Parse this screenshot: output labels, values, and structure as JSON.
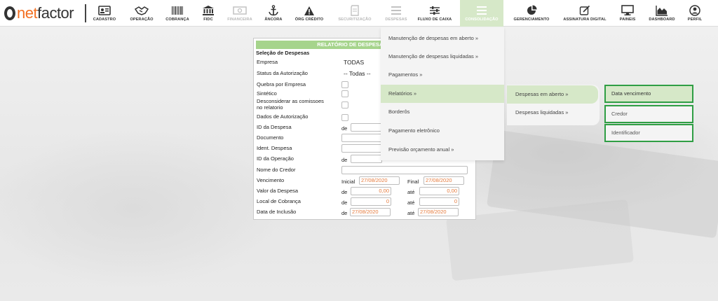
{
  "app": {
    "brand_net": "net",
    "brand_factor": "factor"
  },
  "nav": [
    {
      "key": "cadastro",
      "label": "CADASTRO",
      "icon": "id-card-icon",
      "disabled": false
    },
    {
      "key": "operacao",
      "label": "OPERAÇÃO",
      "icon": "handshake-icon",
      "disabled": false
    },
    {
      "key": "cobranca",
      "label": "COBRANÇA",
      "icon": "barcode-icon",
      "disabled": false
    },
    {
      "key": "fidc",
      "label": "FIDC",
      "icon": "bank-icon",
      "disabled": false
    },
    {
      "key": "financeira",
      "label": "FINANCEIRA",
      "icon": "money-icon",
      "disabled": true
    },
    {
      "key": "ancora",
      "label": "ÂNCORA",
      "icon": "anchor-icon",
      "disabled": false
    },
    {
      "key": "org-credito",
      "label": "ÓRG CRÉDITO",
      "icon": "warning-icon",
      "disabled": false
    },
    {
      "key": "securitizacao",
      "label": "SECURITIZAÇÃO",
      "icon": "document-icon",
      "disabled": true
    },
    {
      "key": "despesas",
      "label": "DESPESAS",
      "icon": "list-icon",
      "disabled": true
    },
    {
      "key": "fluxo-caixa",
      "label": "FLUXO DE CAIXA",
      "icon": "sliders-icon",
      "disabled": false
    },
    {
      "key": "consolidacao",
      "label": "CONSOLIDAÇÃO",
      "icon": "list-icon",
      "disabled": false,
      "active": true
    },
    {
      "key": "gerenciamento",
      "label": "GERENCIAMENTO",
      "icon": "pie-chart-icon",
      "disabled": false
    },
    {
      "key": "assinatura",
      "label": "ASSINATURA DIGITAL",
      "icon": "signature-icon",
      "disabled": false
    },
    {
      "key": "paineis",
      "label": "PAINEIS",
      "icon": "monitor-icon",
      "disabled": false
    },
    {
      "key": "dashboard",
      "label": "DASHBOARD",
      "icon": "area-chart-icon",
      "disabled": false
    },
    {
      "key": "perfil",
      "label": "PERFIL",
      "icon": "user-icon",
      "disabled": false
    }
  ],
  "report": {
    "title": "RELATÓRIO DE DESPESAS EM ABER",
    "section": "Seleção de Despesas",
    "labels": {
      "empresa": "Empresa",
      "status": "Status da Autorização",
      "quebra": "Quebra por Empresa",
      "sintetico": "Sintético",
      "desconsiderar1": "Desconsiderar as comissoes",
      "desconsiderar2": "no relatorio",
      "dados_aut": "Dados de Autorização",
      "id_despesa": "ID da Despesa",
      "documento": "Documento",
      "ident_despesa": "Ident. Despesa",
      "id_operacao": "ID da Operação",
      "nome_credor": "Nome do Credor",
      "vencimento": "Vencimento",
      "valor_despesa": "Valor da Despesa",
      "local_cobranca": "Local de Cobrança",
      "data_inclusao": "Data de Inclusão"
    },
    "de": "de",
    "ate": "até",
    "inicial": "Inicial",
    "final": "Final",
    "empresa_value": "TODAS",
    "status_value": "-- Todas --",
    "venc_inicial": "27/08/2020",
    "venc_final": "27/08/2020",
    "valor_de": "0,00",
    "valor_ate": "0,00",
    "local_de": "0",
    "local_ate": "0",
    "inclusao_de": "27/08/2020",
    "inclusao_ate": "27/08/2020"
  },
  "menu_consolidacao": [
    "Manutenção de despesas em aberto »",
    "Manutenção de despesas liquidadas »",
    "Pagamentos »",
    "Relatórios »",
    "Borderôs",
    "Pagamento eletrônico",
    "Previsão orçamento anual »"
  ],
  "menu_relatorios": [
    "Despesas em aberto »",
    "Despesas liquidadas »"
  ],
  "menu_despesas_aberto": [
    "Data vencimento",
    "Credor",
    "Identificador"
  ]
}
